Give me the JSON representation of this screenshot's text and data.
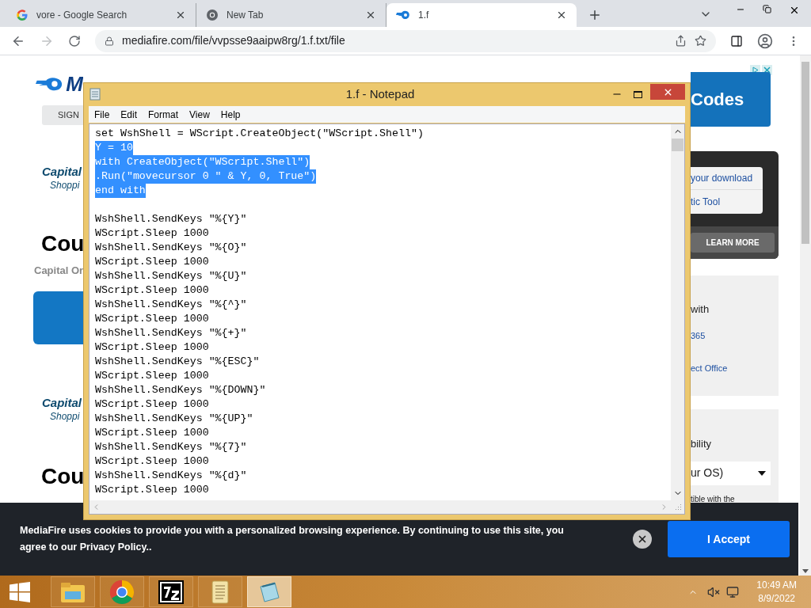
{
  "browser": {
    "tabs": [
      {
        "kind": "google",
        "title": "vore - Google Search",
        "selected": false
      },
      {
        "kind": "chrome",
        "title": "New Tab",
        "selected": false
      },
      {
        "kind": "mediafire",
        "title": "1.f",
        "selected": true
      }
    ],
    "address": "mediafire.com/file/vvpsse9aaipw8rg/1.f.txt/file"
  },
  "page": {
    "left": {
      "logo": "M",
      "sign_button": "SIGN",
      "offers": [
        {
          "brand": "Capital",
          "sub": "Shoppi",
          "heading": "Cou",
          "caption": "Capital Or"
        },
        {
          "brand": "Capital",
          "sub": "Shoppi",
          "heading": "Cou"
        }
      ]
    },
    "right": {
      "ad": "Codes",
      "links": [
        "your download",
        "tic Tool"
      ],
      "learn_more": "LEARN MORE",
      "office_card": {
        "title": "with",
        "lines": [
          "365",
          "ect Office"
        ]
      },
      "os_card": {
        "title": "bility",
        "select": "ur OS)",
        "note": "tible with the"
      }
    }
  },
  "notepad": {
    "title": "1.f - Notepad",
    "menu": [
      "File",
      "Edit",
      "Format",
      "View",
      "Help"
    ],
    "lines": [
      {
        "text": "set WshShell = WScript.CreateObject(\"WScript.Shell\")",
        "selected": false
      },
      {
        "text": "Y = 10",
        "selected": true
      },
      {
        "text": "with CreateObject(\"WScript.Shell\")",
        "selected": true
      },
      {
        "text": ".Run(\"movecursor 0 \" & Y, 0, True\")",
        "selected": true
      },
      {
        "text": "end with",
        "selected": true
      },
      {
        "kind": "blank",
        "selected": false
      },
      {
        "text": "WshShell.SendKeys \"%{Y}\"",
        "selected": false
      },
      {
        "text": "WScript.Sleep 1000",
        "selected": false
      },
      {
        "text": "WshShell.SendKeys \"%{O}\"",
        "selected": false
      },
      {
        "text": "WScript.Sleep 1000",
        "selected": false
      },
      {
        "text": "WshShell.SendKeys \"%{U}\"",
        "selected": false
      },
      {
        "text": "WScript.Sleep 1000",
        "selected": false
      },
      {
        "text": "WshShell.SendKeys \"%{^}\"",
        "selected": false
      },
      {
        "text": "WScript.Sleep 1000",
        "selected": false
      },
      {
        "text": "WshShell.SendKeys \"%{+}\"",
        "selected": false
      },
      {
        "text": "WScript.Sleep 1000",
        "selected": false
      },
      {
        "text": "WshShell.SendKeys \"%{ESC}\"",
        "selected": false
      },
      {
        "text": "WScript.Sleep 1000",
        "selected": false
      },
      {
        "text": "WshShell.SendKeys \"%{DOWN}\"",
        "selected": false
      },
      {
        "text": "WScript.Sleep 1000",
        "selected": false
      },
      {
        "text": "WshShell.SendKeys \"%{UP}\"",
        "selected": false
      },
      {
        "text": "WScript.Sleep 1000",
        "selected": false
      },
      {
        "text": "WshShell.SendKeys \"%{7}\"",
        "selected": false
      },
      {
        "text": "WScript.Sleep 1000",
        "selected": false
      },
      {
        "text": "WshShell.SendKeys \"%{d}\"",
        "selected": false
      },
      {
        "text": "WScript.Sleep 1000",
        "selected": false
      }
    ]
  },
  "cookie_banner": {
    "text": "MediaFire uses cookies to provide you with a personalized browsing experience. By continuing to use this site, you agree to our Privacy Policy..",
    "accept": "I Accept"
  },
  "taskbar": {
    "apps": [
      {
        "kind": "explorer",
        "selected": false
      },
      {
        "kind": "chrome",
        "selected": false
      },
      {
        "kind": "archive",
        "selected": false
      },
      {
        "kind": "scroll",
        "selected": false
      },
      {
        "kind": "notepad",
        "selected": true
      }
    ],
    "time": "10:49 AM",
    "date": "8/9/2022"
  }
}
